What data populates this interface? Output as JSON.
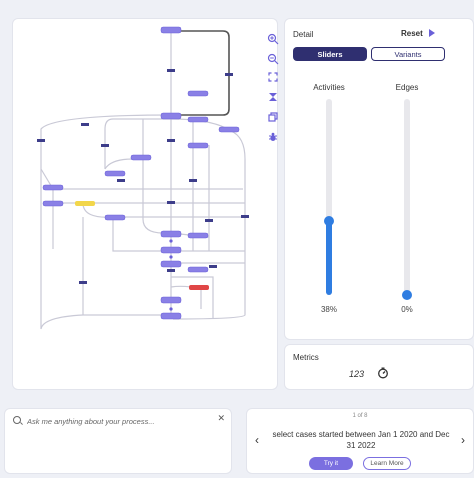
{
  "graph": {
    "zoom_in_icon": "zoom-in-icon",
    "zoom_out_icon": "zoom-out-icon",
    "fit_icon": "expand-icon",
    "hourglass_icon": "hourglass-icon",
    "layers_icon": "layers-icon",
    "bug_icon": "bug-icon"
  },
  "detail": {
    "title": "Detail",
    "reset_label": "Reset",
    "tabs": {
      "sliders": "Sliders",
      "variants": "Variants"
    },
    "activities": {
      "label": "Activities",
      "value_text": "38%",
      "value": 0.38
    },
    "edges": {
      "label": "Edges",
      "value_text": "0%",
      "value": 0.0
    }
  },
  "metrics": {
    "title": "Metrics",
    "numbers_icon_text": "123"
  },
  "ask": {
    "placeholder": "Ask me anything about your process..."
  },
  "suggestion": {
    "page_indicator": "1 of 8",
    "text": "select cases started between Jan 1 2020 and Dec 31 2022",
    "try_label": "Try it",
    "learn_label": "Learn More"
  },
  "colors": {
    "accent": "#7b6fe0",
    "dark": "#2f2f70",
    "slider": "#2f7de1",
    "highlight_yellow": "#f2d64b",
    "highlight_red": "#e04646"
  }
}
